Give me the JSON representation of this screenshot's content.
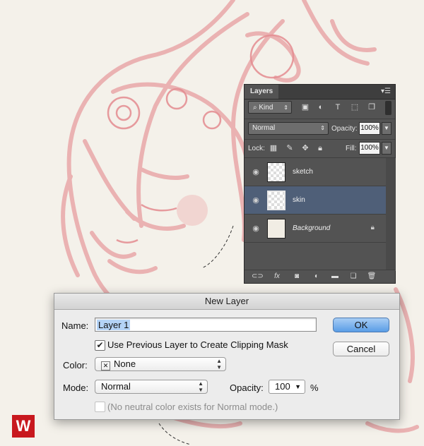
{
  "layers_panel": {
    "tab_label": "Layers",
    "kind_label": "Kind",
    "blend_mode": "Normal",
    "opacity_label": "Opacity:",
    "opacity_value": "100%",
    "lock_label": "Lock:",
    "fill_label": "Fill:",
    "fill_value": "100%",
    "layers": [
      {
        "name": "sketch",
        "selected": false,
        "italic": false
      },
      {
        "name": "skin",
        "selected": true,
        "italic": false
      },
      {
        "name": "Background",
        "selected": false,
        "italic": true
      }
    ],
    "bottom_icons": [
      "link-icon",
      "fx-icon",
      "mask-icon",
      "adjustment-icon",
      "folder-icon",
      "new-layer-icon",
      "trash-icon"
    ]
  },
  "dialog": {
    "title": "New Layer",
    "name_label": "Name:",
    "name_value": "Layer 1",
    "clip_label": "Use Previous Layer to Create Clipping Mask",
    "color_label": "Color:",
    "color_value": "None",
    "mode_label": "Mode:",
    "mode_value": "Normal",
    "opacity_label": "Opacity:",
    "opacity_value": "100",
    "opacity_unit": "%",
    "neutral_label": "(No neutral color exists for Normal mode.)",
    "ok_label": "OK",
    "cancel_label": "Cancel"
  },
  "colors": {
    "sketch": "#e08a8e",
    "canvas": "#f4f1ea",
    "panel": "#535353",
    "selected_layer": "#4f5f78",
    "ok_button": "#5a9de6"
  }
}
